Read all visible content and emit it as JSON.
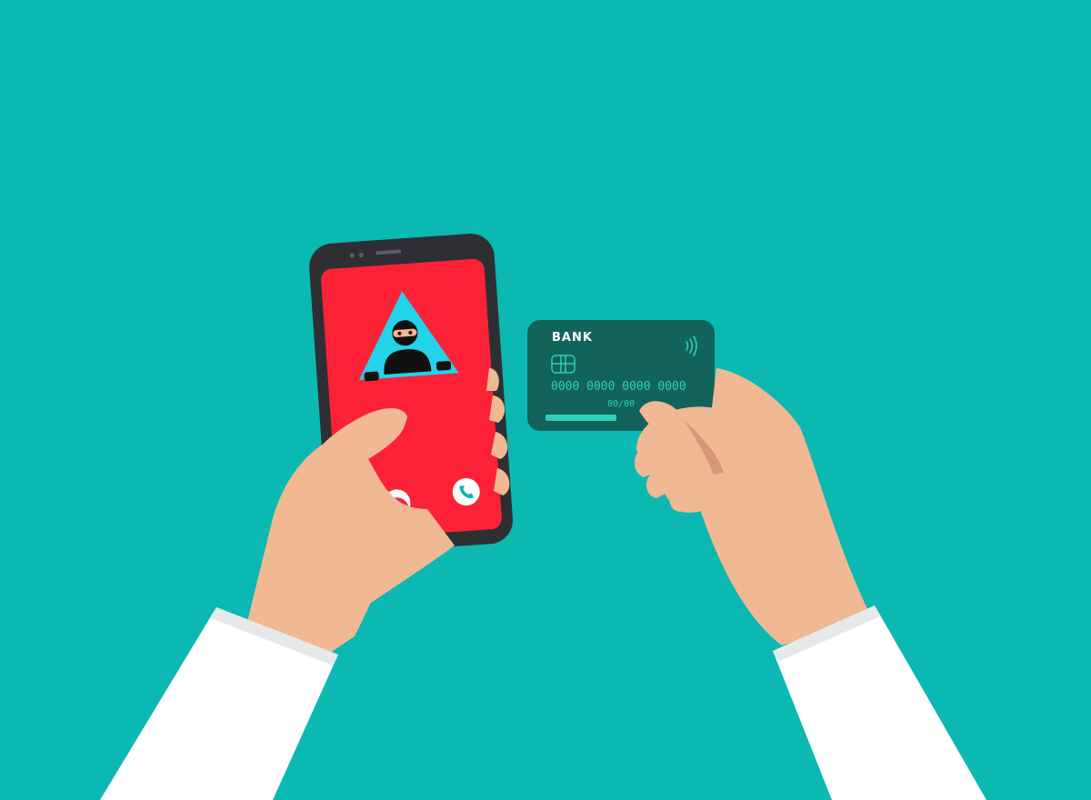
{
  "colors": {
    "background": "#0bb8b2",
    "skin": "#f0b893",
    "skin_shadow": "#d9977a",
    "sleeve": "#ffffff",
    "phone_body": "#2d2f33",
    "phone_screen": "#fb2238",
    "warning_triangle": "#22d3ea",
    "card": "#12635a",
    "card_accent": "#2fd0ba"
  },
  "phone": {
    "call_decline_icon": "phone-hangup-icon",
    "call_accept_icon": "phone-answer-icon"
  },
  "card": {
    "bank_label": "BANK",
    "number": "0000 0000 0000 0000",
    "expiry": "00/00",
    "contactless_icon": "contactless-icon",
    "chip_icon": "chip-icon"
  }
}
